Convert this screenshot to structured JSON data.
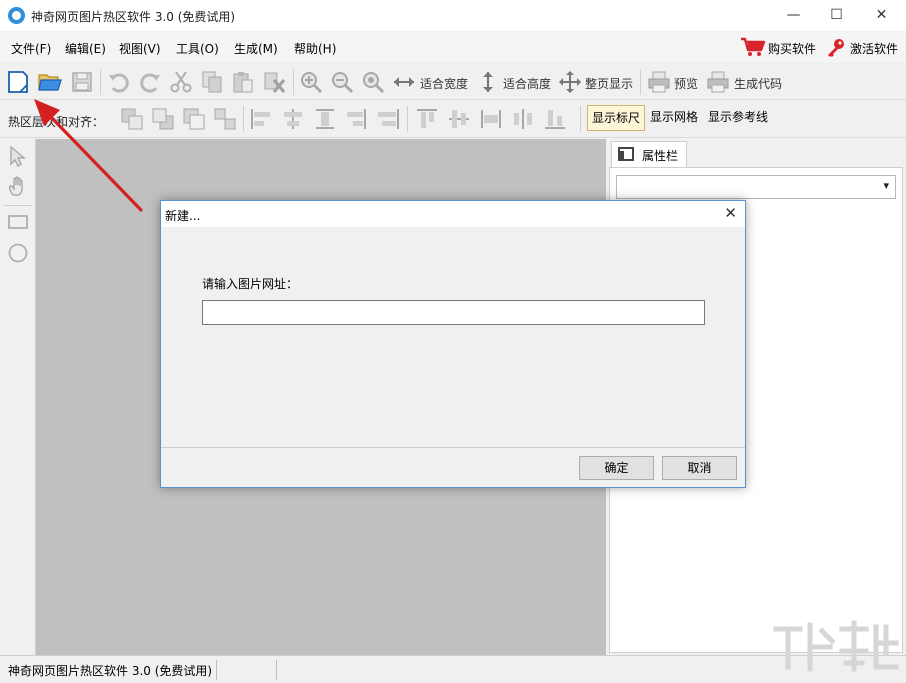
{
  "window": {
    "title": "神奇网页图片热区软件 3.0 (免费试用)",
    "minimize_glyph": "—",
    "maximize_glyph": "☐",
    "close_glyph": "✕"
  },
  "menu": {
    "items": [
      "文件(F)",
      "编辑(E)",
      "视图(V)",
      "工具(O)",
      "生成(M)",
      "帮助(H)"
    ],
    "buy_label": "购买软件",
    "activate_label": "激活软件"
  },
  "toolbar": {
    "fit_width": "适合宽度",
    "fit_height": "适合高度",
    "fit_page": "整页显示",
    "preview": "预览",
    "generate_code": "生成代码"
  },
  "toolbar2": {
    "label": "热区层次和对齐：",
    "show_ruler": "显示标尺",
    "show_grid": "显示网格",
    "show_guides": "显示参考线"
  },
  "properties": {
    "tab_label": "属性栏",
    "selected_value": ""
  },
  "status": {
    "text": "神奇网页图片热区软件 3.0 (免费试用)"
  },
  "dialog": {
    "title": "新建...",
    "close_glyph": "✕",
    "prompt": "请输入图片网址：",
    "url_value": "",
    "ok_label": "确定",
    "cancel_label": "取消"
  },
  "colors": {
    "accent_blue": "#2f8fd8",
    "cart_red": "#d8232a",
    "arrow_red": "#d42020",
    "canvas_gray": "#c0c0c0",
    "dialog_border": "#5a8fd0"
  }
}
